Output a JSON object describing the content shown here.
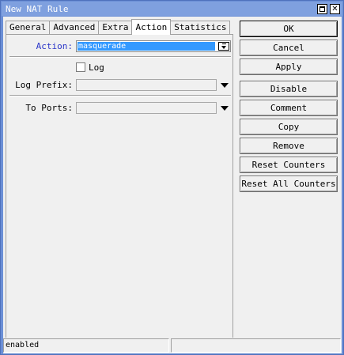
{
  "window": {
    "title": "New NAT Rule",
    "title_bar_color": "#7fa0df",
    "maximize_icon": "maximize-icon",
    "close_icon": "close-icon",
    "close_glyph": "✕"
  },
  "tabs": [
    {
      "label": "General",
      "active": false
    },
    {
      "label": "Advanced",
      "active": false
    },
    {
      "label": "Extra",
      "active": false
    },
    {
      "label": "Action",
      "active": true
    },
    {
      "label": "Statistics",
      "active": false
    }
  ],
  "form": {
    "action": {
      "label": "Action:",
      "value": "masquerade"
    },
    "log": {
      "label": "Log",
      "checked": false
    },
    "log_prefix": {
      "label": "Log Prefix:",
      "value": ""
    },
    "to_ports": {
      "label": "To Ports:",
      "value": ""
    }
  },
  "buttons": {
    "ok": "OK",
    "cancel": "Cancel",
    "apply": "Apply",
    "disable": "Disable",
    "comment": "Comment",
    "copy": "Copy",
    "remove": "Remove",
    "reset_counters": "Reset Counters",
    "reset_all_counters": "Reset All Counters"
  },
  "status_bar": {
    "state": "enabled",
    "secondary": ""
  },
  "colors": {
    "selection": "#3399ff",
    "label_blue": "#2a35c8"
  }
}
